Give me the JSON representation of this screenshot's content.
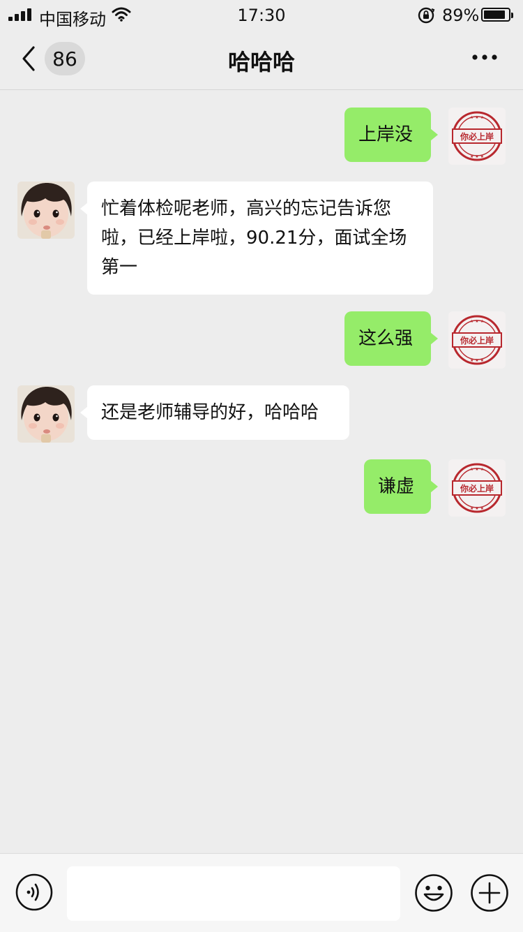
{
  "status_bar": {
    "carrier": "中国移动",
    "time": "17:30",
    "battery_percent": "89%",
    "battery_level": 0.89,
    "icons": [
      "signal-icon",
      "wifi-icon",
      "rotation-lock-icon",
      "battery-icon"
    ]
  },
  "nav": {
    "back_icon": "chevron-left-icon",
    "unread_count": "86",
    "title": "哈哈哈",
    "more_icon": "more-icon"
  },
  "messages": [
    {
      "direction": "out",
      "text": "上岸没",
      "avatar": "stamp-avatar"
    },
    {
      "direction": "in",
      "text": "忙着体检呢老师，高兴的忘记告诉您啦，已经上岸啦，90.21分，面试全场第一",
      "avatar": "child-avatar"
    },
    {
      "direction": "out",
      "text": "这么强",
      "avatar": "stamp-avatar"
    },
    {
      "direction": "in",
      "text": "还是老师辅导的好，哈哈哈",
      "avatar": "child-avatar"
    },
    {
      "direction": "out",
      "text": "谦虚",
      "avatar": "stamp-avatar"
    }
  ],
  "stamp_text": "你必上岸",
  "input_bar": {
    "voice_icon": "voice-icon",
    "text_value": "",
    "emoji_icon": "emoji-icon",
    "plus_icon": "plus-icon"
  },
  "colors": {
    "background": "#ededed",
    "outgoing_bubble": "#95ec69",
    "incoming_bubble": "#ffffff",
    "stamp_red": "#b8282e"
  }
}
